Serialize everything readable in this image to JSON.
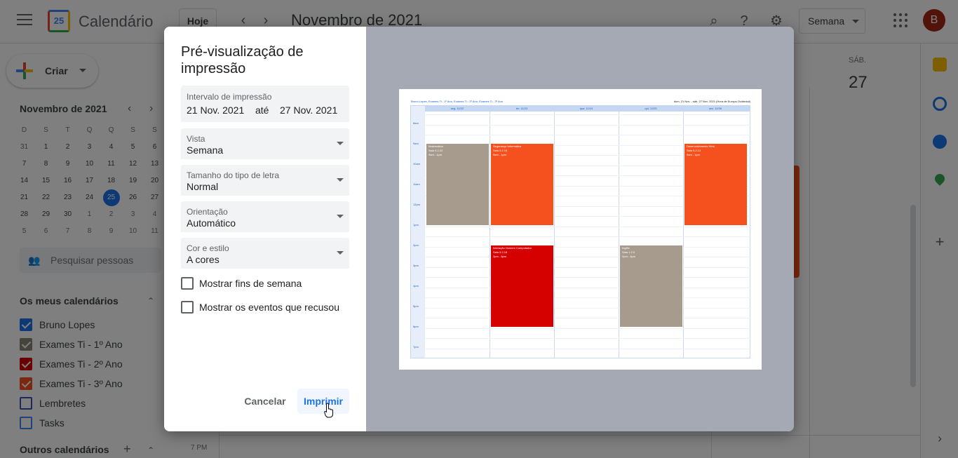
{
  "topbar": {
    "app_name": "Calendário",
    "logo_text": "25",
    "today": "Hoje",
    "month": "Novembro de 2021",
    "view": "Semana",
    "avatar": "B"
  },
  "sidebar": {
    "create": "Criar",
    "mini_month": "Novembro de 2021",
    "weekdays": [
      "D",
      "S",
      "T",
      "Q",
      "Q",
      "S",
      "S"
    ],
    "days": [
      "31",
      "1",
      "2",
      "3",
      "4",
      "5",
      "6",
      "7",
      "8",
      "9",
      "10",
      "11",
      "12",
      "13",
      "14",
      "15",
      "16",
      "17",
      "18",
      "19",
      "20",
      "21",
      "22",
      "23",
      "24",
      "25",
      "26",
      "27",
      "28",
      "29",
      "30",
      "1",
      "2",
      "3",
      "4",
      "5",
      "6",
      "7",
      "8",
      "9",
      "10",
      "11"
    ],
    "search_people": "Pesquisar pessoas",
    "my_calendars": "Os meus calendários",
    "calendars": [
      {
        "label": "Bruno Lopes",
        "color": "#1a73e8",
        "checked": true
      },
      {
        "label": "Exames Ti - 1º Ano",
        "color": "#8d8478",
        "checked": true
      },
      {
        "label": "Exames Ti - 2º Ano",
        "color": "#d50000",
        "checked": true
      },
      {
        "label": "Exames Ti - 3º Ano",
        "color": "#f4511e",
        "checked": true
      },
      {
        "label": "Lembretes",
        "color": "#3f51b5",
        "checked": false
      },
      {
        "label": "Tasks",
        "color": "#4285f4",
        "checked": false
      }
    ],
    "other_calendars": "Outros calendários"
  },
  "main": {
    "day_name": "SÁB.",
    "day_num": "27",
    "time_label": "7 PM"
  },
  "dialog": {
    "title": "Pré-visualização de impressão",
    "range_label": "Intervalo de impressão",
    "range_from": "21 Nov. 2021",
    "range_sep": "até",
    "range_to": "27 Nov. 2021",
    "view_label": "Vista",
    "view_value": "Semana",
    "font_label": "Tamanho do tipo de letra",
    "font_value": "Normal",
    "orientation_label": "Orientação",
    "orientation_value": "Automático",
    "color_label": "Cor e estilo",
    "color_value": "A cores",
    "show_weekends": "Mostrar fins de semana",
    "show_declined": "Mostrar os eventos que recusou",
    "cancel": "Cancelar",
    "print": "Imprimir"
  },
  "preview": {
    "header": "Bruno Lopes, Exames Ti - 1º Ano, Exames Ti - 2º Ano, Exames Ti - 3º Ano",
    "range": "dom. 21 Nov. - sáb. 27 Nov. 2021 (Hora de Europa Ocidental)",
    "days": [
      "seg. 11/22",
      "ter. 11/23",
      "qua. 11/24",
      "qui. 11/25",
      "sex. 11/26"
    ],
    "times": [
      "8am",
      "9am",
      "10am",
      "11am",
      "12pm",
      "1pm",
      "2pm",
      "3pm",
      "4pm",
      "5pm",
      "6pm",
      "7pm"
    ],
    "events": [
      {
        "title": "Matemática",
        "room": "Sala 5.2.22",
        "time": "9am - 1pm",
        "color": "#a79b8e"
      },
      {
        "title": "Segurança Informática",
        "room": "Sala 5.2.18",
        "time": "9am - 1pm",
        "color": "#f4511e"
      },
      {
        "title": "Desenvolvimento Web",
        "room": "Sala 5.2.13",
        "time": "9am - 1pm",
        "color": "#f4511e"
      },
      {
        "title": "Interação Homem Computador",
        "room": "Sala 5.2.18",
        "time": "2pm - 6pm",
        "color": "#d50000"
      },
      {
        "title": "Inglês",
        "room": "Sala 1.2.5",
        "time": "2pm - 6pm",
        "color": "#a79b8e"
      }
    ]
  }
}
